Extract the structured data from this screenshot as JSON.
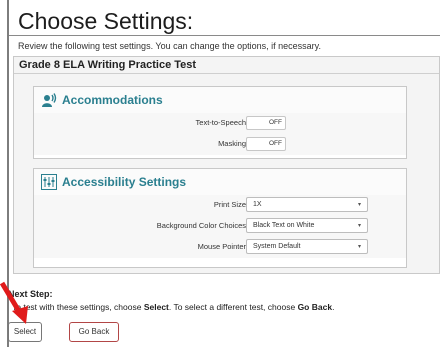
{
  "page": {
    "title": "Choose Settings:",
    "intro": "Review the following test settings. You can change the options, if necessary."
  },
  "test": {
    "name": "Grade 8 ELA Writing Practice Test"
  },
  "accommodations": {
    "title": "Accommodations",
    "icon": "accommodations-icon",
    "rows": [
      {
        "label": "Text-to-Speech",
        "value": "OFF"
      },
      {
        "label": "Masking",
        "value": "OFF"
      }
    ]
  },
  "accessibility": {
    "title": "Accessibility Settings",
    "icon": "accessibility-settings-icon",
    "rows": [
      {
        "label": "Print Size",
        "value": "1X"
      },
      {
        "label": "Background Color Choices",
        "value": "Black Text on White"
      },
      {
        "label": "Mouse Pointer",
        "value": "System Default"
      }
    ]
  },
  "next_step": {
    "title": "Next Step:",
    "prefix": "To test with these settings, choose ",
    "select_word": "Select",
    "middle": ". To select a different test, choose ",
    "back_word": "Go Back",
    "suffix": "."
  },
  "buttons": {
    "select_label": "Select",
    "back_label": "Go Back"
  },
  "colors": {
    "section_title": "#2a7f8f",
    "button_border": "#b24646",
    "annotation_arrow": "#e01b1b"
  }
}
